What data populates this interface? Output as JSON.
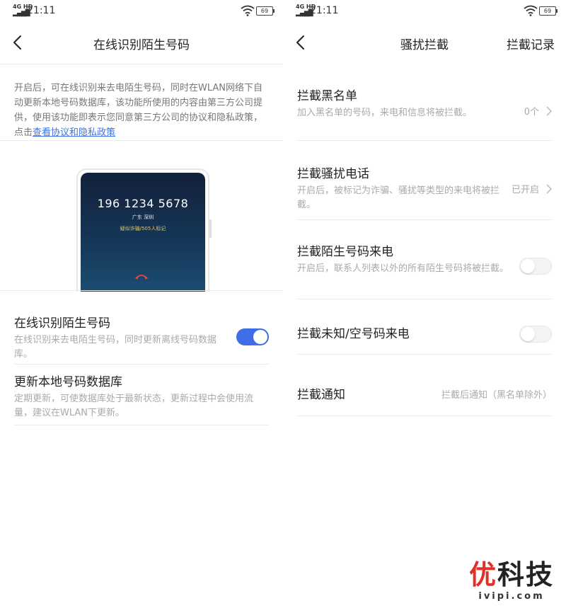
{
  "status_bar": {
    "network": "4G HD",
    "time": "21:11",
    "battery": "69"
  },
  "left": {
    "title": "在线识别陌生号码",
    "intro_text": "开启后，可在线识别来去电陌生号码，同时在WLAN网络下自动更新本地号码数据库，该功能所使用的内容由第三方公司提供，使用该功能即表示您同意第三方公司的协议和隐私政策，点击",
    "intro_link": "查看协议和隐私政策",
    "phone_preview": {
      "number": "196 1234 5678",
      "location": "广东 深圳",
      "tag": "疑似诈骗/505人标记"
    },
    "settings": [
      {
        "title": "在线识别陌生号码",
        "desc": "在线识别来去电陌生号码，同时更新离线号码数据库。",
        "toggle": true
      },
      {
        "title": "更新本地号码数据库",
        "desc": "定期更新，可使数据库处于最新状态，更新过程中会使用流量，建议在WLAN下更新。"
      }
    ]
  },
  "right": {
    "title": "骚扰拦截",
    "action": "拦截记录",
    "items": [
      {
        "title": "拦截黑名单",
        "desc": "加入黑名单的号码，来电和信息将被拦截。",
        "value": "0个"
      },
      {
        "title": "拦截骚扰电话",
        "desc": "开启后，被标记为诈骗、骚扰等类型的来电将被拦截。",
        "value": "已开启"
      },
      {
        "title": "拦截陌生号码来电",
        "desc": "开启后，联系人列表以外的所有陌生号码将被拦截。",
        "toggle": false
      },
      {
        "title": "拦截未知/空号码来电",
        "toggle": false
      },
      {
        "title": "拦截通知",
        "value": "拦截后通知（黑名单除外）"
      }
    ]
  },
  "watermark": {
    "logo_red": "优",
    "logo_rest": "科技",
    "url": "ivipi.com"
  },
  "colors": {
    "accent": "#3f6ee6",
    "link": "#3d73e4",
    "toggle_off": "#f4f4f4"
  }
}
